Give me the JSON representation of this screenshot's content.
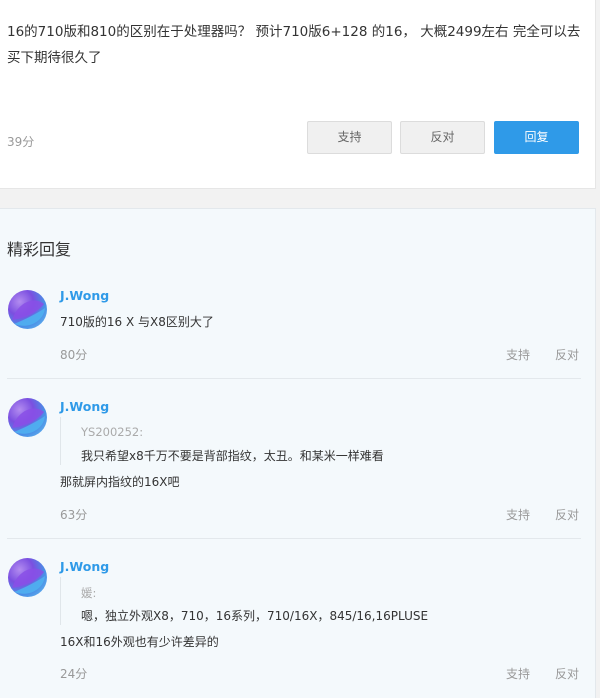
{
  "post": {
    "text": "16的710版和810的区别在于处理器吗？ 预计710版6+128 的16， 大概2499左右 完全可以去买下期待很久了",
    "score": "39分",
    "support_label": "支持",
    "oppose_label": "反对",
    "reply_label": "回复"
  },
  "replies_section": {
    "title": "精彩回复",
    "items": [
      {
        "username": "J.Wong",
        "content": " 710版的16 X 与X8区别大了",
        "score": "80分",
        "support_label": "支持",
        "oppose_label": "反对"
      },
      {
        "username": "J.Wong",
        "quote_author": "YS200252:",
        "quote_text": "我只希望x8千万不要是背部指纹，太丑。和某米一样难看",
        "content": "那就屏内指纹的16X吧",
        "score": "63分",
        "support_label": "支持",
        "oppose_label": "反对"
      },
      {
        "username": "J.Wong",
        "quote_author": "媛:",
        "quote_text": "嗯，独立外观X8，710，16系列，710/16X，845/16,16PLUSE",
        "content": "16X和16外观也有少许差异的",
        "score": "24分",
        "support_label": "支持",
        "oppose_label": "反对"
      }
    ]
  },
  "colors": {
    "accent": "#2f9ae8",
    "reply_bg": "#f4f9fc"
  }
}
